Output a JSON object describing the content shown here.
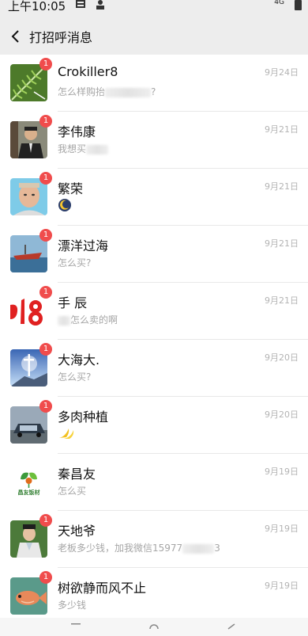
{
  "status": {
    "time": "上午10:05",
    "network": "4G"
  },
  "header": {
    "title": "打招呼消息"
  },
  "messages": [
    {
      "name": "Crokiller8",
      "preview": "怎么样购抬",
      "preview_tail": "?",
      "date": "9月24日",
      "badge": "1"
    },
    {
      "name": "李伟康",
      "preview": "我想买",
      "preview_tail": "",
      "date": "9月21日",
      "badge": "1"
    },
    {
      "name": "繁荣",
      "preview": "",
      "preview_tail": "",
      "date": "9月21日",
      "badge": "1"
    },
    {
      "name": "漂洋过海",
      "preview": "怎么买?",
      "preview_tail": "",
      "date": "9月21日",
      "badge": "1"
    },
    {
      "name": "手 辰",
      "preview": "怎么卖的啊",
      "preview_tail": "",
      "date": "9月21日",
      "badge": "1"
    },
    {
      "name": "大海大.",
      "preview": "怎么买?",
      "preview_tail": "",
      "date": "9月20日",
      "badge": "1"
    },
    {
      "name": "多肉种植",
      "preview": "",
      "preview_tail": "",
      "date": "9月20日",
      "badge": "1"
    },
    {
      "name": "秦昌友",
      "preview": "怎么买",
      "preview_tail": "",
      "date": "9月19日",
      "badge": ""
    },
    {
      "name": "天地爷",
      "preview": "老板多少钱，加我微信15977",
      "preview_tail": "3",
      "date": "9月19日",
      "badge": "1"
    },
    {
      "name": "树欲静而风不止",
      "preview": "多少钱",
      "preview_tail": "",
      "date": "9月19日",
      "badge": "1"
    }
  ],
  "avatars": [
    "fern-leaf",
    "man-in-suit",
    "man-portrait",
    "boat-at-sea",
    "red-number-art",
    "cross-sky",
    "car-outdoor",
    "changyou-logo",
    "costume-man",
    "fish-photo"
  ],
  "logo": {
    "text": "昌友饭材"
  }
}
